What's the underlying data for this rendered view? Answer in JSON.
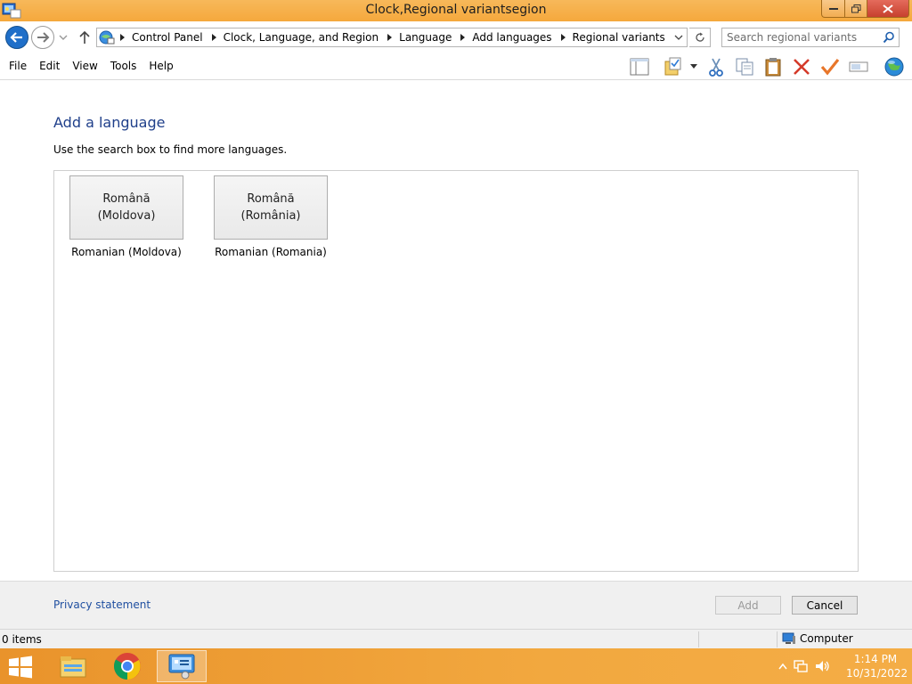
{
  "window": {
    "title": "Clock,Regional variantsegion"
  },
  "address": {
    "crumbs": [
      "Control Panel",
      "Clock, Language, and Region",
      "Language",
      "Add languages",
      "Regional variants"
    ]
  },
  "search": {
    "placeholder": "Search regional variants"
  },
  "menu": {
    "items": [
      "File",
      "Edit",
      "View",
      "Tools",
      "Help"
    ]
  },
  "content": {
    "heading": "Add a language",
    "hint": "Use the search box to find more languages.",
    "languages": [
      {
        "native_line1": "Română",
        "native_line2": "(Moldova)",
        "caption": "Romanian (Moldova)"
      },
      {
        "native_line1": "Română",
        "native_line2": "(România)",
        "caption": "Romanian (Romania)"
      }
    ]
  },
  "footer": {
    "privacy_link": "Privacy statement",
    "add_label": "Add",
    "cancel_label": "Cancel"
  },
  "status": {
    "items_count": "0 items",
    "location": "Computer"
  },
  "taskbar": {
    "time": "1:14 PM",
    "date": "10/31/2022"
  },
  "colors": {
    "accent": "#f2a434",
    "heading": "#1f3f8a",
    "link": "#1f4fa0",
    "back_button": "#1f6fc9"
  }
}
